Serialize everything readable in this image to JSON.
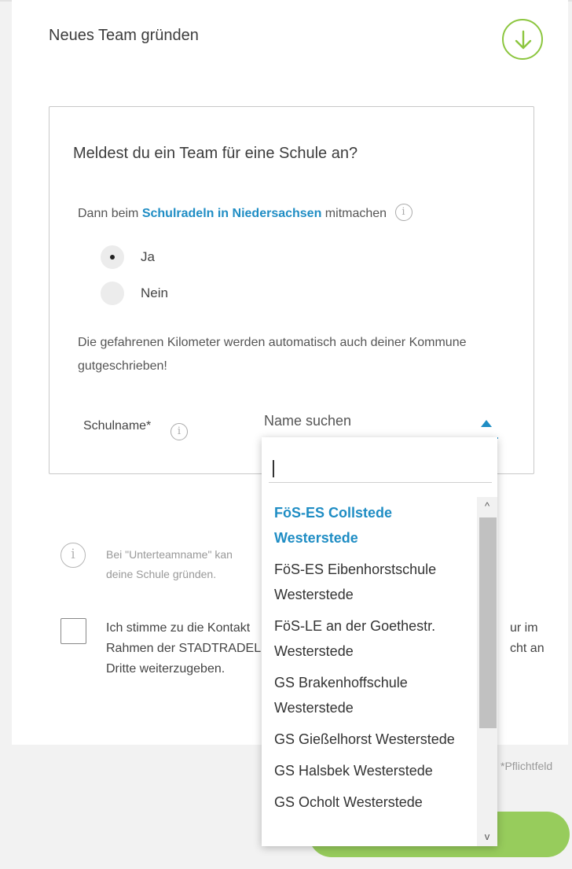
{
  "form": {
    "title": "Neues Team gründen",
    "download_icon": "arrow-down-circle-icon"
  },
  "school_panel": {
    "question": "Meldest du ein Team für eine Schule an?",
    "intro_prefix": "Dann beim ",
    "intro_link": "Schulradeln in Niedersachsen",
    "intro_suffix": " mitmachen",
    "info_glyph": "i",
    "options": [
      {
        "label": "Ja",
        "checked": true
      },
      {
        "label": "Nein",
        "checked": false
      }
    ],
    "note": "Die gefahrenen Kilometer werden automatisch auch deiner Kommune gutgeschrieben!",
    "school_label": "Schulname*",
    "select": {
      "placeholder": "Name suchen"
    }
  },
  "hint": {
    "text": "Bei \"Unterteamname\" kan\ndeine Schule gründen."
  },
  "consent": {
    "text": "Ich stimme zu die Kontakt\nRahmen der STADTRADEL\nDritte weiterzugeben.",
    "text_end": "ur im\ncht an"
  },
  "required_note": "*Pflichtfeld",
  "dropdown": {
    "search_value": "",
    "items": [
      "FöS-ES Collstede Westerstede",
      "FöS-ES Eibenhorstschule Westerstede",
      "FöS-LE an der Goethestr. Westerstede",
      "GS Brakenhoffschule Westerstede",
      "GS Gießelhorst Westerstede",
      "GS Halsbek Westerstede",
      "GS Ocholt Westerstede"
    ],
    "scroll_up": "^",
    "scroll_down": "v"
  },
  "colors": {
    "accent": "#1f8dc4",
    "brand_green": "#8cc63f",
    "button_green": "#97cc5c"
  }
}
